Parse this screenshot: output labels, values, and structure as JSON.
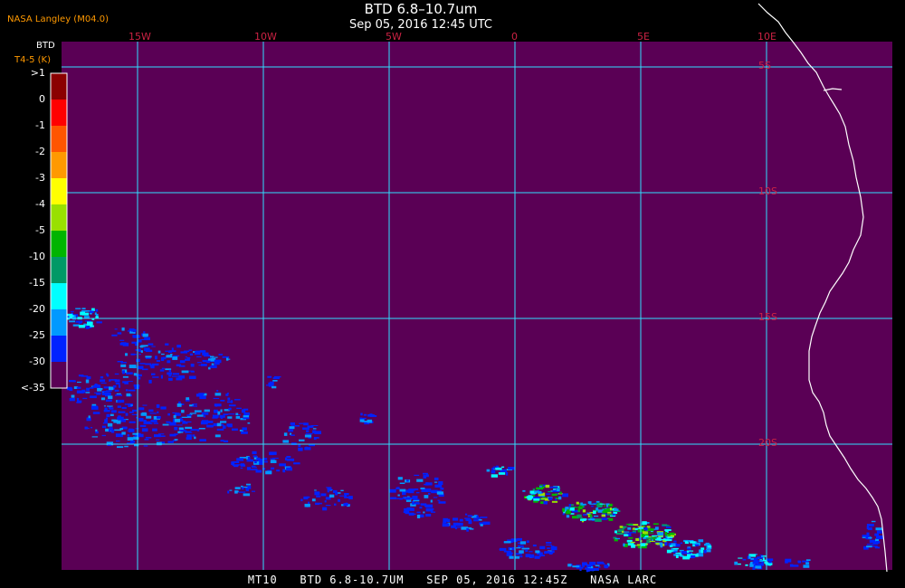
{
  "header": {
    "title": "BTD 6.8–10.7um",
    "subtitle": "Sep 05, 2016 12:45 UTC",
    "org": "NASA Langley (M04.0)"
  },
  "legend": {
    "title": "BTD",
    "units": "T4-5 (K)",
    "labels": [
      ">1",
      "0",
      "-1",
      "-2",
      "-3",
      "-4",
      "-5",
      "-10",
      "-15",
      "-20",
      "-25",
      "-30",
      "<-35"
    ],
    "colors": [
      "#8b0000",
      "#ff0000",
      "#ff5500",
      "#ff9900",
      "#ffff00",
      "#99e000",
      "#00b400",
      "#009966",
      "#00ffff",
      "#0099ff",
      "#0022ff",
      "#5a0055"
    ]
  },
  "map": {
    "background_color": "#5a0055",
    "grid_color": "#30e0ff",
    "label_color": "#cc2244",
    "lon_labels": [
      "15W",
      "10W",
      "5W",
      "0",
      "5E",
      "10E"
    ],
    "lat_labels": [
      "5S",
      "10S",
      "15S",
      "20S"
    ]
  },
  "footer": "MT10   BTD 6.8-10.7UM   SEP 05, 2016 12:45Z   NASA LARC"
}
